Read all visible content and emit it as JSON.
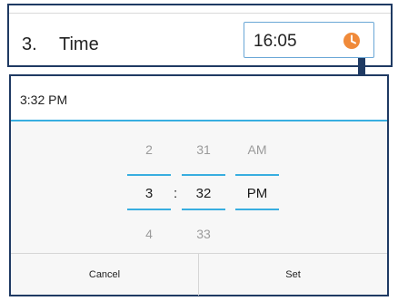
{
  "form": {
    "row_number": "3.",
    "row_label": "Time",
    "time_value": "16:05",
    "clock_icon": "clock-icon"
  },
  "dialog": {
    "title": "3:32 PM",
    "hour": {
      "prev": "2",
      "selected": "3",
      "next": "4"
    },
    "minute": {
      "prev": "31",
      "selected": "32",
      "next": "33"
    },
    "ampm": {
      "prev": "AM",
      "selected": "PM"
    },
    "separator": ":",
    "cancel_label": "Cancel",
    "set_label": "Set"
  },
  "colors": {
    "accent": "#38aee0",
    "frame": "#1f3a63",
    "clock_orange": "#f08a3a"
  }
}
